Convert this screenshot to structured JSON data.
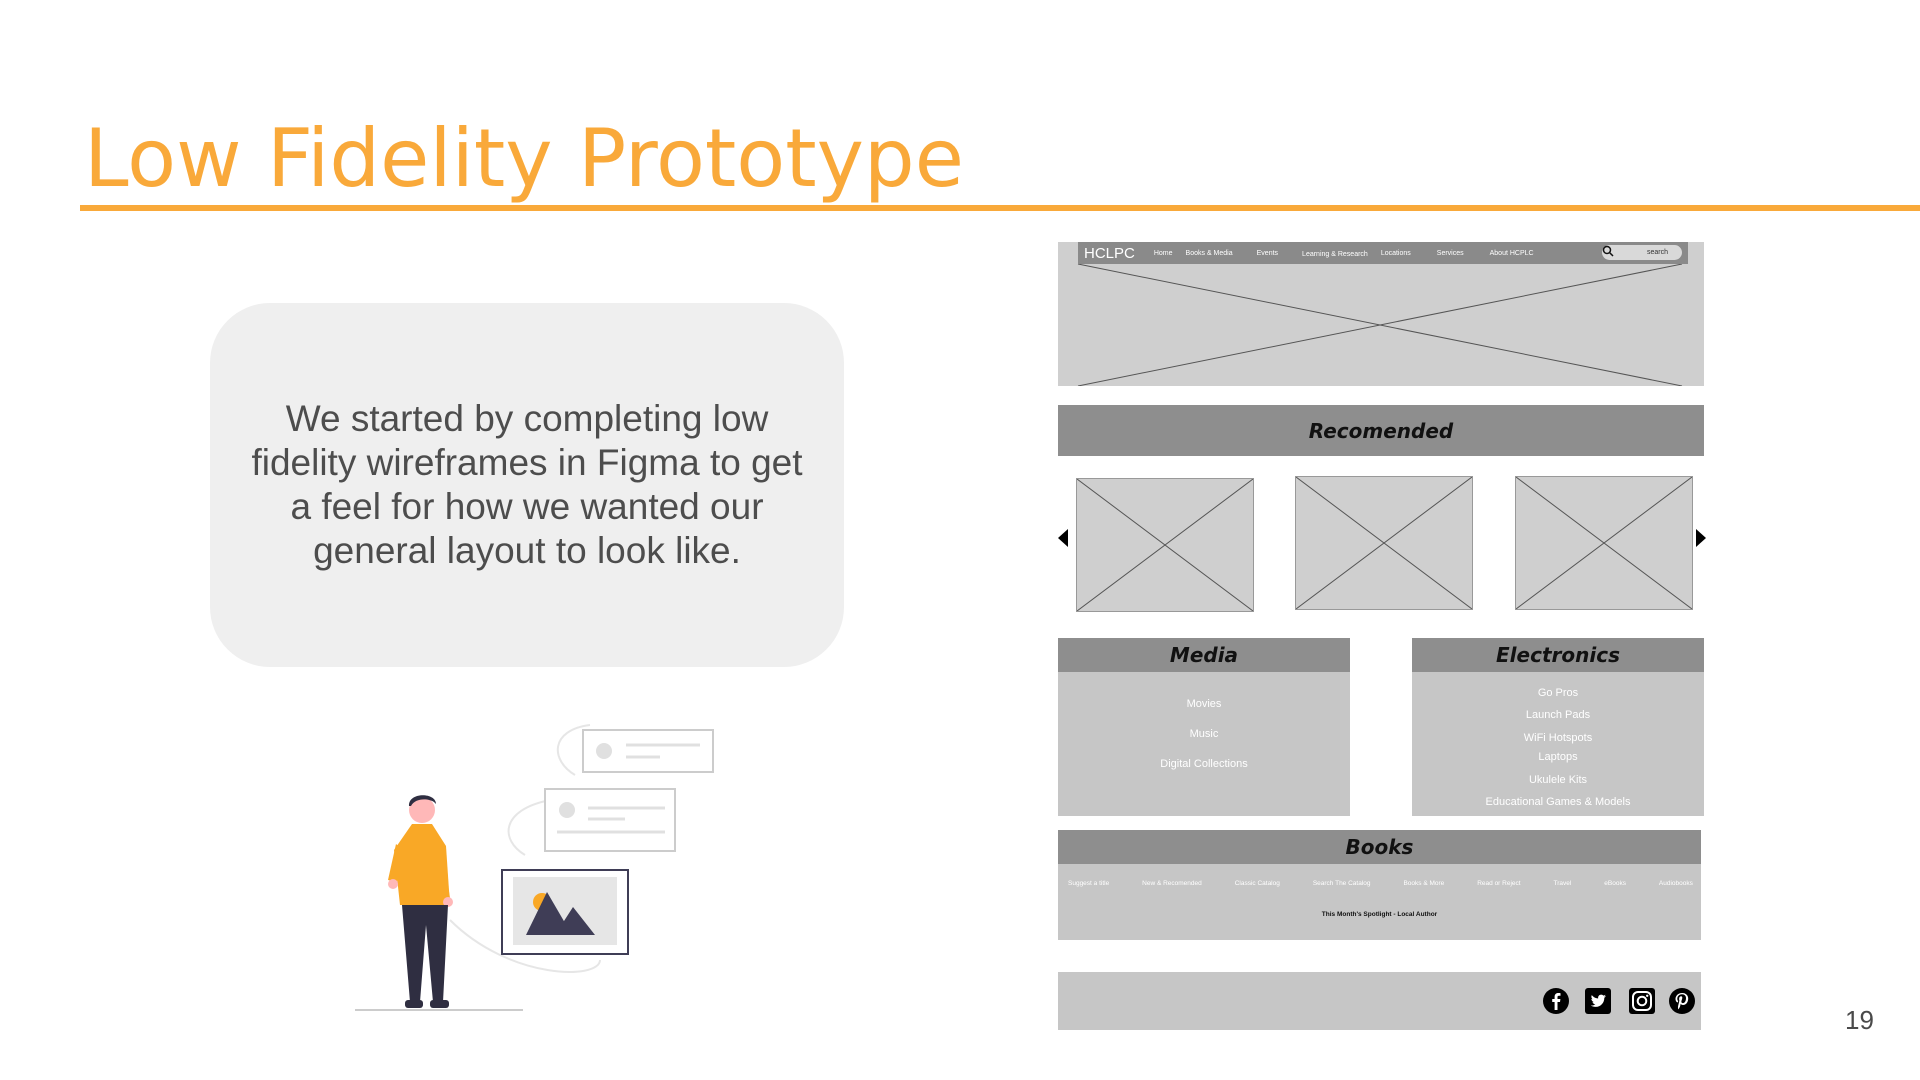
{
  "slide": {
    "title": "Low Fidelity Prototype",
    "callout_text": "We started by completing low fidelity wireframes in Figma to get a feel for how we wanted our general layout to look like.",
    "page_number": "19"
  },
  "wireframe": {
    "logo": "HCLPC",
    "nav": [
      "Home",
      "Books & Media",
      "Events",
      "Learning & Research",
      "Locations",
      "Services",
      "About HCPLC"
    ],
    "search_placeholder": "search",
    "recommended_title": "Recomended",
    "media": {
      "title": "Media",
      "items": [
        "Movies",
        "Music",
        "Digital Collections"
      ]
    },
    "electronics": {
      "title": "Electronics",
      "items": [
        "Go Pros",
        "Launch Pads",
        "WiFi Hotspots",
        "Laptops",
        "Ukulele Kits",
        "Educational Games & Models"
      ]
    },
    "books": {
      "title": "Books",
      "links": [
        "Suggest a title",
        "New & Recomended",
        "Classic Catalog",
        "Search The Catalog",
        "Books & More",
        "Read or Reject",
        "Travel",
        "eBooks",
        "Audiobooks"
      ],
      "spotlight": "This Month's Spotlight - Local Author"
    },
    "social_icons": [
      "facebook-icon",
      "twitter-icon",
      "instagram-icon",
      "pinterest-icon"
    ]
  },
  "colors": {
    "accent": "#f9a93a",
    "callout_bg": "#efefef",
    "wireframe_dark": "#8e8e8e",
    "wireframe_light": "#c6c6c6",
    "figure_shirt": "#f9a826",
    "figure_dark": "#2f2e41"
  }
}
